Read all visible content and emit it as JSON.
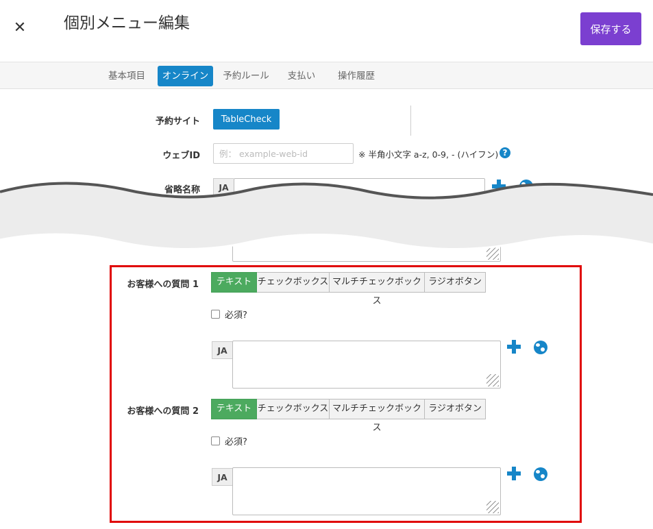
{
  "header": {
    "title": "個別メニュー編集",
    "save_label": "保存する"
  },
  "tabs": [
    "基本項目",
    "オンライン",
    "予約ルール",
    "支払い",
    "操作履歴"
  ],
  "active_tab": "オンライン",
  "form": {
    "site_label": "予約サイト",
    "site_button": "TableCheck",
    "webid_label": "ウェブID",
    "webid_placeholder": "例： example-web-id",
    "webid_hint": "※ 半角小文字 a-z, 0-9, - (ハイフン)",
    "help_glyph": "?",
    "short_name_label": "省略名称",
    "lang_code": "JA"
  },
  "questions": [
    {
      "label": "お客様への質問 1",
      "types": [
        "テキスト",
        "チェックボックス",
        "マルチチェックボックス",
        "ラジオボタン"
      ],
      "selected": "テキスト",
      "required_label": "必須?",
      "required": false,
      "lang_code": "JA"
    },
    {
      "label": "お客様への質問 2",
      "types": [
        "テキスト",
        "チェックボックス",
        "マルチチェックボックス",
        "ラジオボタン"
      ],
      "selected": "テキスト",
      "required_label": "必須?",
      "required": false,
      "lang_code": "JA"
    }
  ],
  "colors": {
    "accent": "#1686c8",
    "save": "#7b3fd0",
    "selected_type": "#4caa5f",
    "highlight": "#e00000"
  },
  "icons": {
    "close": "close-icon",
    "add": "plus-icon",
    "translate": "globe-icon",
    "help": "help-icon"
  }
}
